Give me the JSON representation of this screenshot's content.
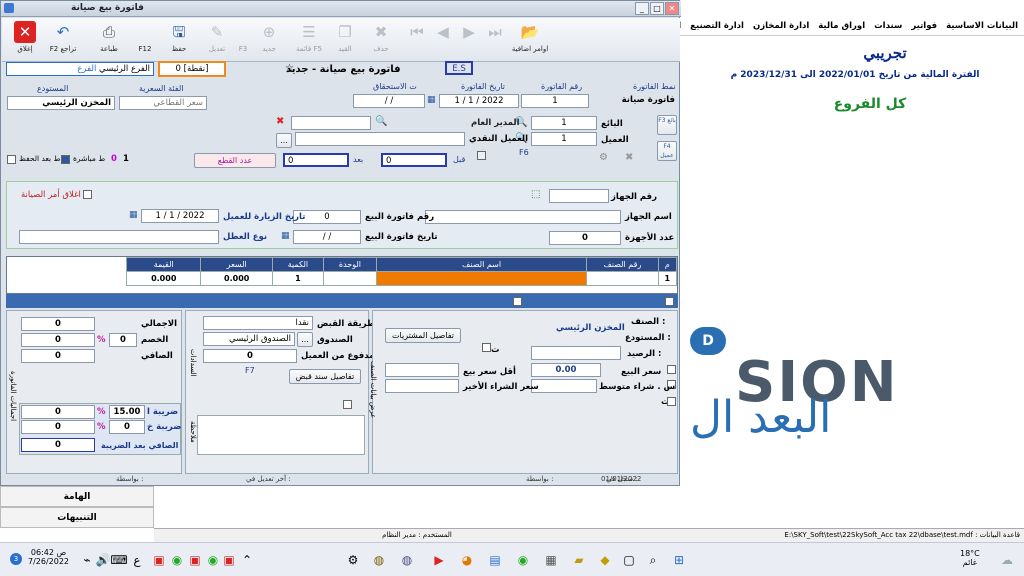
{
  "menu": [
    "البيانات الاساسية",
    "فواتير",
    "سندات",
    "اوراق مالية",
    "ادارة المخازن",
    "ادارة التصنيع",
    "اد"
  ],
  "bg": {
    "title": "تجريبي",
    "period": "الفترة المالية من تاريخ 2022/01/01 الى 2023/12/31 م",
    "branch": "كل الفروع",
    "logo_latin": "SION",
    "logo_arabic": "البعد ال",
    "logo_badge": "D",
    "status_path": "E:\\SKY_Soft\\test\\22SkySoft_Acc tax 22\\dbase\\test.mdf : قاعدة البيانات",
    "side1": "الهامة",
    "side2": "التنبيهات",
    "user_status": "المستخدم : مدير النظام"
  },
  "dialog": {
    "title": "فاتورة بيع صيانة",
    "heading": "فاتورة بيع صيانة - جديد"
  },
  "toolbar": {
    "close": "إغلاق",
    "undo": "F2 تراجع",
    "print": "طباعة",
    "save_key": "F12",
    "save": "حفظ",
    "edit": "تعديل",
    "edit_key": "F3",
    "new": "جديد",
    "list": "قائمة F5",
    "copy": "القيد",
    "delete": "حذف",
    "extra": "اوامر اضافية"
  },
  "branch": {
    "label": "الفرع",
    "value": "الفرع الرئيسي"
  },
  "points": {
    "label": "[نقطة]",
    "value": "0"
  },
  "es": "E.S",
  "head": {
    "type_label": "نمط الفاتورة",
    "type_value": "فاتورة صيانة",
    "no_label": "رقم الفاتورة",
    "no_value": "1",
    "date_label": "تاريخ الفاتورة",
    "date_value": "1 / 1 / 2022",
    "due_label": "ت الاستحقاق",
    "due_value": "/ /",
    "price_label": "الفئة السعرية",
    "price_value": "سعر القطاعي",
    "store_label": "المستودع",
    "store_value": "المخزن الرئيسي"
  },
  "seller": {
    "label": "البائع",
    "value": "1",
    "name": "المدير العام",
    "f3": "F3 بائع"
  },
  "customer": {
    "label": "العميل",
    "value": "1",
    "name": "العميل النقدي",
    "f6": "F6",
    "f4": "F4 عميل"
  },
  "cut": {
    "label": "عدد القطع",
    "before_label": "قبل",
    "before": "0",
    "after_label": "بعد",
    "after": "0"
  },
  "flags": {
    "num": "1",
    "zero": "0",
    "direct": "ط مباشرة",
    "after_save": "ط بعد الحفظ"
  },
  "device": {
    "no_label": "رقم الجهاز",
    "close_label": "اغلاق أمر الصيانة",
    "name_label": "اسم الجهاز",
    "sale_no_label": "رقم فاتورة البيع",
    "sale_no": "0",
    "visit_label": "تاريخ الزيارة للعميل",
    "visit": "1 / 1 / 2022",
    "count_label": "عدد الأجهزة",
    "count": "0",
    "sale_date_label": "تاريخ فاتورة البيع",
    "sale_date": "/ /",
    "fault_label": "نوع العطل"
  },
  "table": {
    "headers": [
      "م",
      "رقم الصنف",
      "اسم الصنف",
      "الوحدة",
      "الكمية",
      "السعر",
      "القيمة"
    ],
    "row": [
      "1",
      "",
      "",
      "",
      "1",
      "0.000",
      "0.000"
    ]
  },
  "summary": {
    "total_label": "الاجمالي",
    "total": "0",
    "disc_label": "الخصم",
    "disc": "0",
    "disc_pct": "0",
    "pct": "%",
    "net_label": "الصافي",
    "net": "0",
    "tax1_label": "ضريبة ا",
    "tax1_pct": "15.00",
    "tax1": "0",
    "tax2_label": "ضريبة خ",
    "tax2_pct": "0",
    "tax2": "0",
    "net_tax_label": "الصافي بعد الضريبة",
    "net_tax": "0",
    "side_label": "اجماليات الفاتورة"
  },
  "pay": {
    "method_label": "طريقة القبض",
    "method": "نقدا",
    "box_label": "الصندوق",
    "box": "الصندوق الرئيسي",
    "paid_label": "مدفوع من العميل",
    "paid": "0",
    "f7": "F7",
    "receipt_btn": "تفاصيل سند قبض",
    "side_label": "السدادات",
    "note_label": "ملاحظة"
  },
  "item": {
    "btn": "تفاصيل المشتريات",
    "item_label": "الصنف :",
    "store_label": "المستودع :",
    "store": "المخزن الرئيسي",
    "bal_label": "الرصيد :",
    "price_label": "سعر البيع",
    "price": "0.00",
    "min_label": "أقل سعر بيع",
    "avg_label": "س . شراء متوسط",
    "last_label": "سعر الشراء الأخير",
    "side_label": "عرض بيانات الصنف",
    "t": "ت"
  },
  "footer": {
    "mediator": "بواسطة :",
    "edit_user": "آخر تعديل في :",
    "reg": "سجل في :",
    "reg_date": "01/01/2022",
    "by": "بواسطة :"
  },
  "taskbar": {
    "time": "06:42 ص",
    "date": "7/26/2022",
    "temp": "18°C",
    "weather": "غائم",
    "lang": "ع",
    "notif": "3"
  }
}
